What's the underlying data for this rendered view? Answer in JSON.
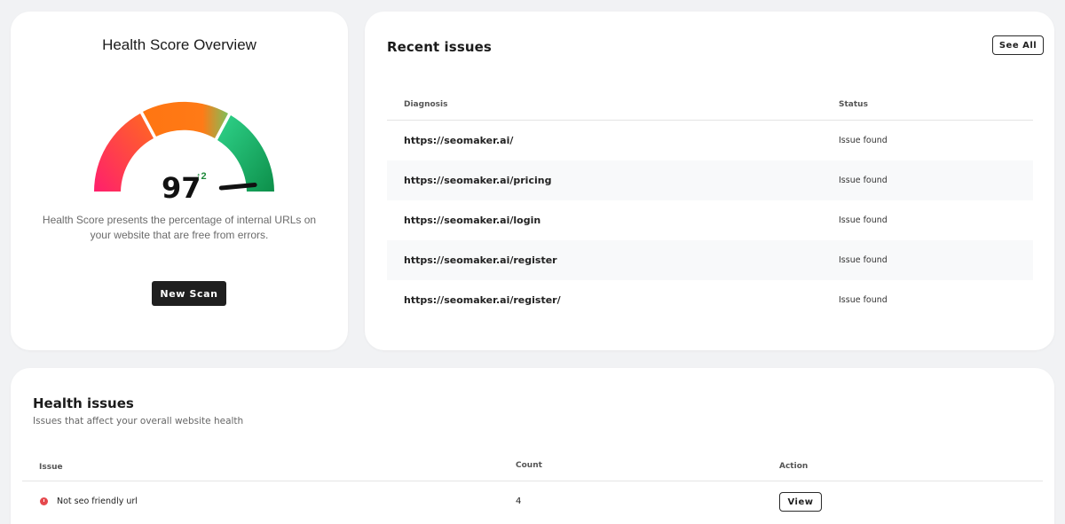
{
  "health": {
    "title": "Health Score Overview",
    "score": "97",
    "delta": "↑2",
    "description": "Health Score presents the percentage of internal URLs on your website that are free from errors.",
    "new_scan_label": "New Scan",
    "score_fraction": 0.97,
    "colors": {
      "low": "#f5296b",
      "mid": "#ff7a1a",
      "high": "#14a15a",
      "needle": "#111111"
    }
  },
  "recent": {
    "title": "Recent issues",
    "see_all_label": "See All",
    "columns": {
      "diagnosis": "Diagnosis",
      "status": "Status"
    },
    "rows": [
      {
        "url": "https://seomaker.ai/",
        "status": "Issue found"
      },
      {
        "url": "https://seomaker.ai/pricing",
        "status": "Issue found"
      },
      {
        "url": "https://seomaker.ai/login",
        "status": "Issue found"
      },
      {
        "url": "https://seomaker.ai/register",
        "status": "Issue found"
      },
      {
        "url": "https://seomaker.ai/register/",
        "status": "Issue found"
      }
    ]
  },
  "issues": {
    "title": "Health issues",
    "subtitle": "Issues that affect your overall website health",
    "columns": {
      "issue": "Issue",
      "count": "Count",
      "action": "Action"
    },
    "rows": [
      {
        "name": "Not seo friendly url",
        "count": "4",
        "action_label": "View",
        "severity_color": "#e5484d"
      }
    ]
  }
}
